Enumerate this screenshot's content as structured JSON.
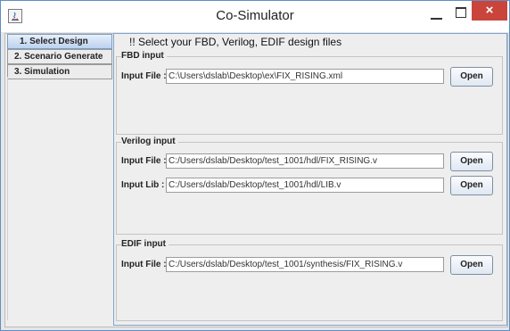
{
  "window": {
    "title": "Co-Simulator",
    "close_glyph": "×",
    "icons": {
      "app": "java-app-icon",
      "minimize": "minimize-icon",
      "maximize": "maximize-icon",
      "close": "close-icon"
    },
    "colors": {
      "close_button": "#c9453c",
      "selected_tab": "#bcd2ef",
      "border_accent": "#5e8fc5"
    }
  },
  "tabs": [
    {
      "label": "1. Select Design",
      "selected": true
    },
    {
      "label": "2. Scenario Generate",
      "selected": false
    },
    {
      "label": "3. Simulation",
      "selected": false
    }
  ],
  "main": {
    "headline": "!! Select your FBD, Verilog, EDIF design files",
    "fbd": {
      "title": "FBD input",
      "file_label": "Input File :",
      "file_value": "C:\\Users\\dslab\\Desktop\\ex\\FIX_RISING.xml",
      "open_label": "Open"
    },
    "verilog": {
      "title": "Verilog input",
      "file_label": "Input File :",
      "file_value": "C:/Users/dslab/Desktop/test_1001/hdl/FIX_RISING.v",
      "lib_label": "Input Lib :",
      "lib_value": "C:/Users/dslab/Desktop/test_1001/hdl/LIB.v",
      "open_label": "Open"
    },
    "edif": {
      "title": "EDIF input",
      "file_label": "Input File :",
      "file_value": "C:/Users/dslab/Desktop/test_1001/synthesis/FIX_RISING.v",
      "open_label": "Open"
    }
  }
}
